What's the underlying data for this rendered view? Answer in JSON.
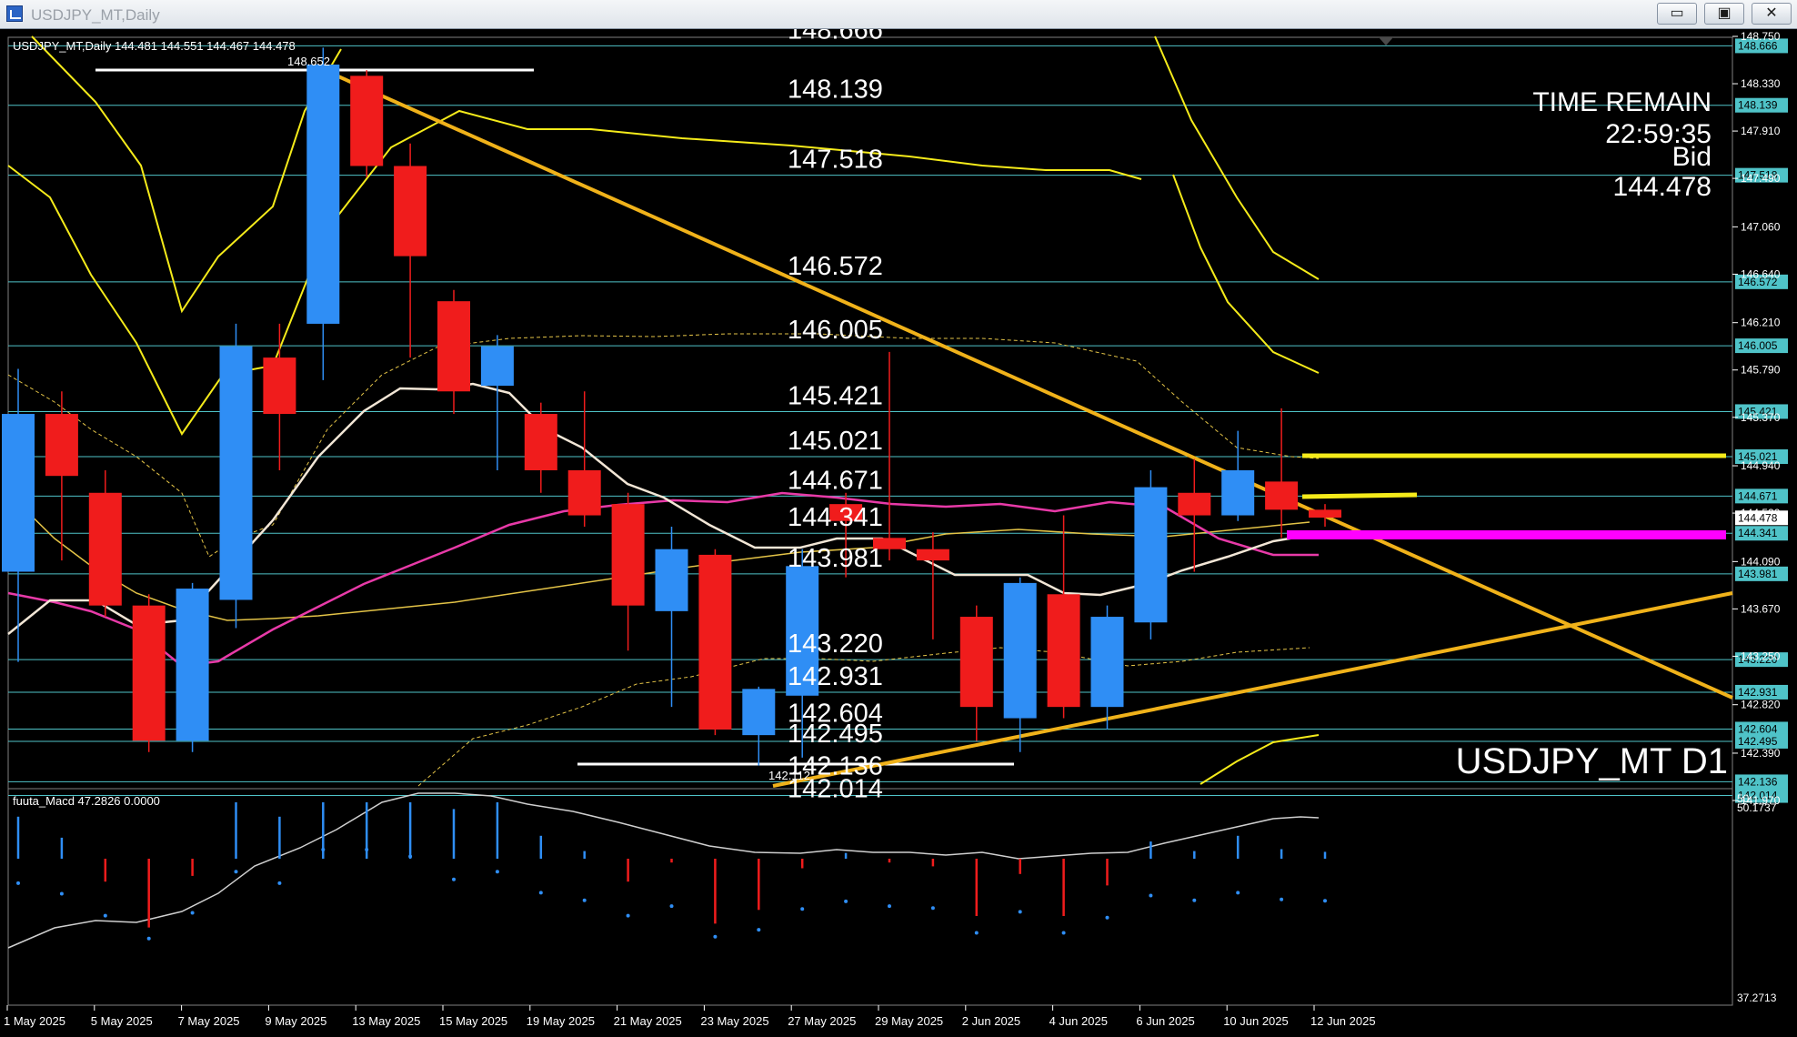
{
  "window": {
    "title": "USDJPY_MT,Daily",
    "minimize": "▭",
    "maximize": "▣",
    "close": "✕"
  },
  "header": {
    "info": "USDJPY_MT,Daily  144.481 144.551 144.467 144.478",
    "high_label": "148.652",
    "low_label": "142.112"
  },
  "timer": {
    "label": "TIME REMAIN",
    "value": "22:59:35",
    "bid_label": "Bid",
    "bid_value": "144.478"
  },
  "symbol_label": "USDJPY_MT D1",
  "levels": [
    {
      "price": 148.666,
      "text": "148.666"
    },
    {
      "price": 148.139,
      "text": "148.139"
    },
    {
      "price": 147.518,
      "text": "147.518"
    },
    {
      "price": 146.572,
      "text": "146.572"
    },
    {
      "price": 146.005,
      "text": "146.005"
    },
    {
      "price": 145.421,
      "text": "145.421"
    },
    {
      "price": 145.021,
      "text": "145.021"
    },
    {
      "price": 144.671,
      "text": "144.671"
    },
    {
      "price": 144.341,
      "text": "144.341"
    },
    {
      "price": 143.981,
      "text": "143.981"
    },
    {
      "price": 143.22,
      "text": "143.220"
    },
    {
      "price": 142.931,
      "text": "142.931"
    },
    {
      "price": 142.604,
      "text": "142.604"
    },
    {
      "price": 142.495,
      "text": "142.495"
    },
    {
      "price": 142.136,
      "text": "142.136"
    },
    {
      "price": 142.014,
      "text": "142.014"
    }
  ],
  "price_axis": [
    "148.750",
    "148.330",
    "147.910",
    "147.490",
    "147.060",
    "146.640",
    "146.210",
    "145.790",
    "145.370",
    "144.940",
    "144.520",
    "144.090",
    "143.670",
    "143.250",
    "142.820",
    "142.390",
    "141.970"
  ],
  "current_price": "144.478",
  "date_axis": [
    {
      "date": "1 May 2025",
      "bar": 0
    },
    {
      "date": "5 May 2025",
      "bar": 2
    },
    {
      "date": "7 May 2025",
      "bar": 4
    },
    {
      "date": "9 May 2025",
      "bar": 6
    },
    {
      "date": "13 May 2025",
      "bar": 8
    },
    {
      "date": "15 May 2025",
      "bar": 10
    },
    {
      "date": "19 May 2025",
      "bar": 12
    },
    {
      "date": "21 May 2025",
      "bar": 14
    },
    {
      "date": "23 May 2025",
      "bar": 16
    },
    {
      "date": "27 May 2025",
      "bar": 18
    },
    {
      "date": "29 May 2025",
      "bar": 20
    },
    {
      "date": "2 Jun 2025",
      "bar": 22
    },
    {
      "date": "4 Jun 2025",
      "bar": 24
    },
    {
      "date": "6 Jun 2025",
      "bar": 26
    },
    {
      "date": "10 Jun 2025",
      "bar": 28
    },
    {
      "date": "12 Jun 2025",
      "bar": 30
    }
  ],
  "macd": {
    "label": "fuuta_Macd 47.2826  0.0000",
    "axis_top": "50.1737",
    "axis_50": "50",
    "axis_bottom": "37.2713"
  },
  "colors": {
    "bull": "#2f8ef5",
    "bear": "#f01c1c",
    "grid_line": "#4fc3c8",
    "trend_line": "#f0b21a",
    "band": "#f5eb1a",
    "ma_white": "#f2e6d6",
    "ma_magenta": "#e83aa8",
    "highlight": "#ff00ff"
  },
  "chart_data": {
    "type": "candlestick",
    "series": [
      {
        "name": "candles",
        "values": [
          {
            "o": 144.0,
            "h": 145.8,
            "l": 143.2,
            "c": 145.4
          },
          {
            "o": 145.4,
            "h": 145.6,
            "l": 144.1,
            "c": 144.85
          },
          {
            "o": 144.7,
            "h": 144.9,
            "l": 143.6,
            "c": 143.7
          },
          {
            "o": 143.7,
            "h": 143.8,
            "l": 142.4,
            "c": 142.5
          },
          {
            "o": 142.5,
            "h": 143.9,
            "l": 142.4,
            "c": 143.85
          },
          {
            "o": 143.75,
            "h": 146.2,
            "l": 143.5,
            "c": 146.0
          },
          {
            "o": 145.9,
            "h": 146.2,
            "l": 144.9,
            "c": 145.4
          },
          {
            "o": 146.2,
            "h": 148.65,
            "l": 145.7,
            "c": 148.5
          },
          {
            "o": 148.4,
            "h": 148.45,
            "l": 147.5,
            "c": 147.6
          },
          {
            "o": 147.6,
            "h": 147.8,
            "l": 145.9,
            "c": 146.8
          },
          {
            "o": 146.4,
            "h": 146.5,
            "l": 145.4,
            "c": 145.6
          },
          {
            "o": 145.65,
            "h": 146.1,
            "l": 144.9,
            "c": 146.0
          },
          {
            "o": 145.4,
            "h": 145.5,
            "l": 144.7,
            "c": 144.9
          },
          {
            "o": 144.9,
            "h": 145.6,
            "l": 144.4,
            "c": 144.5
          },
          {
            "o": 144.6,
            "h": 144.7,
            "l": 143.3,
            "c": 143.7
          },
          {
            "o": 143.65,
            "h": 144.4,
            "l": 142.8,
            "c": 144.2
          },
          {
            "o": 144.15,
            "h": 144.2,
            "l": 142.55,
            "c": 142.6
          },
          {
            "o": 142.55,
            "h": 142.98,
            "l": 142.28,
            "c": 142.96
          },
          {
            "o": 142.9,
            "h": 144.2,
            "l": 142.35,
            "c": 144.05
          },
          {
            "o": 144.6,
            "h": 144.7,
            "l": 143.95,
            "c": 144.45
          },
          {
            "o": 144.3,
            "h": 145.95,
            "l": 144.1,
            "c": 144.2
          },
          {
            "o": 144.2,
            "h": 144.35,
            "l": 143.4,
            "c": 144.1
          },
          {
            "o": 143.6,
            "h": 143.7,
            "l": 142.5,
            "c": 142.8
          },
          {
            "o": 142.7,
            "h": 143.95,
            "l": 142.4,
            "c": 143.9
          },
          {
            "o": 143.8,
            "h": 144.5,
            "l": 142.7,
            "c": 142.8
          },
          {
            "o": 142.8,
            "h": 143.7,
            "l": 142.6,
            "c": 143.6
          },
          {
            "o": 143.55,
            "h": 144.9,
            "l": 143.4,
            "c": 144.75
          },
          {
            "o": 144.7,
            "h": 145.0,
            "l": 144.0,
            "c": 144.5
          },
          {
            "o": 144.5,
            "h": 145.25,
            "l": 144.45,
            "c": 144.9
          },
          {
            "o": 144.8,
            "h": 145.45,
            "l": 144.3,
            "c": 144.55
          },
          {
            "o": 144.55,
            "h": 144.6,
            "l": 144.4,
            "c": 144.48
          }
        ]
      }
    ],
    "ylim": [
      141.97,
      148.75
    ]
  }
}
